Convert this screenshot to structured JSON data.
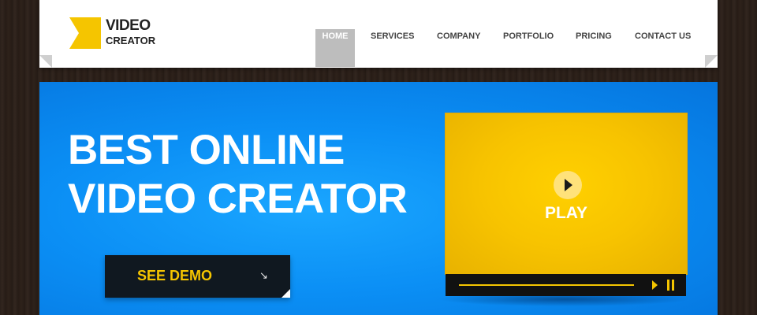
{
  "logo": {
    "line1": "VIDEO",
    "line2": "CREATOR",
    "color": "#f5c500"
  },
  "nav": {
    "items": [
      {
        "label": "HOME",
        "active": true
      },
      {
        "label": "SERVICES",
        "active": false
      },
      {
        "label": "COMPANY",
        "active": false
      },
      {
        "label": "PORTFOLIO",
        "active": false
      },
      {
        "label": "PRICING",
        "active": false
      },
      {
        "label": "CONTACT US",
        "active": false
      }
    ]
  },
  "hero": {
    "headline_line1": "BEST ONLINE",
    "headline_line2": "VIDEO CREATOR",
    "demo_button": "SEE DEMO",
    "demo_arrow": "↘",
    "background": "#0b8ff5"
  },
  "video": {
    "play_label": "PLAY",
    "accent": "#f5c500",
    "controls": {
      "play_icon": "play-icon",
      "pause_icon": "pause-icon"
    }
  }
}
